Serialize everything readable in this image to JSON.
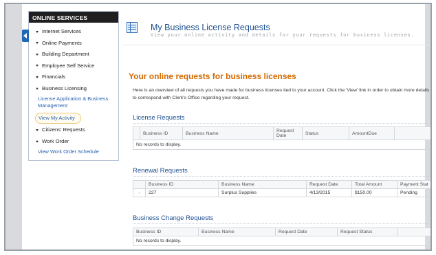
{
  "sidebar": {
    "header": "ONLINE SERVICES",
    "items": [
      {
        "label": "Internet Services",
        "arrow": "down"
      },
      {
        "label": "Online Payments",
        "arrow": "down"
      },
      {
        "label": "Building Department",
        "arrow": "down"
      },
      {
        "label": "Employee Self Service",
        "arrow": "down"
      },
      {
        "label": "Financials",
        "arrow": "down"
      },
      {
        "label": "Business Licensing",
        "arrow": "up"
      }
    ],
    "licensing_links": [
      "License Application & Business Management",
      "View My Activity"
    ],
    "more_items": [
      {
        "label": "Citizens' Requests",
        "arrow": "down"
      },
      {
        "label": "Work Order",
        "arrow": "up"
      }
    ],
    "work_order_link": "View Work Order Schedule"
  },
  "header": {
    "title": "My Business License Requests",
    "subtitle": "View your online activity and details for your requests for business licenses."
  },
  "main": {
    "section_title": "Your online requests for business licenses",
    "intro": "Here is an overview of all requests you have made for business licenses tied to your account. Click the 'View' link in order to obtain more details or to correspond with Clerk's Office regarding your request.",
    "license_requests": {
      "title": "License Requests",
      "columns": [
        "Business ID",
        "Business Name",
        "Request Date",
        "Status",
        "AmountDue"
      ],
      "empty": "No records to display."
    },
    "renewal_requests": {
      "title": "Renewal Requests",
      "columns": [
        "Business ID",
        "Business Name",
        "Request Date",
        "Total Amount",
        "Payment Stat"
      ],
      "rows": [
        {
          "id": "227",
          "name": "Surplus Supplies",
          "date": "4/13/2015",
          "amount": "$150.00",
          "status": "Pending"
        }
      ]
    },
    "change_requests": {
      "title": "Business Change Requests",
      "columns": [
        "Business ID",
        "Business Name",
        "Request Date",
        "Request Status"
      ],
      "empty": "No records to display."
    }
  }
}
